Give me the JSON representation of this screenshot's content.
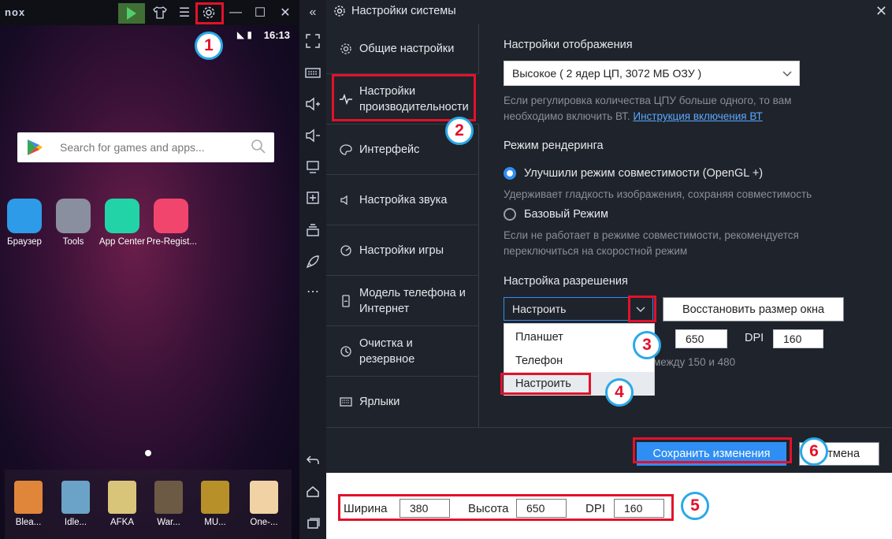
{
  "emulator": {
    "logo": "nox",
    "time": "16:13",
    "search_placeholder": "Search for games and apps...",
    "apps": [
      {
        "label": "Браузер",
        "color": "#2d9be8"
      },
      {
        "label": "Tools",
        "color": "#8a8fa0"
      },
      {
        "label": "App Center",
        "color": "#23d3a8"
      },
      {
        "label": "Pre-Regist...",
        "color": "#f2456e"
      }
    ],
    "dock_apps": [
      {
        "label": "Blea...",
        "color": "#e0863a"
      },
      {
        "label": "Idle...",
        "color": "#6aa3c7"
      },
      {
        "label": "AFKA",
        "color": "#d9c57a"
      },
      {
        "label": "War...",
        "color": "#6c5a45"
      },
      {
        "label": "MU...",
        "color": "#b8902a"
      },
      {
        "label": "One-...",
        "color": "#f0d2a4"
      }
    ]
  },
  "settings": {
    "title": "Настройки системы",
    "sidebar": [
      {
        "label": "Общие настройки",
        "icon": "gear-icon"
      },
      {
        "label": "Настройки производительности",
        "icon": "pulse-icon"
      },
      {
        "label": "Интерфейс",
        "icon": "palette-icon"
      },
      {
        "label": "Настройка звука",
        "icon": "speaker-icon"
      },
      {
        "label": "Настройки игры",
        "icon": "gamepad-icon"
      },
      {
        "label": "Модель телефона и Интернет",
        "icon": "phone-wifi-icon"
      },
      {
        "label": "Очистка и резервное",
        "icon": "history-icon"
      },
      {
        "label": "Ярлыки",
        "icon": "keyboard-icon"
      }
    ],
    "display": {
      "heading": "Настройки отображения",
      "value": "Высокое ( 2 ядер ЦП, 3072 МБ ОЗУ )",
      "note_line1": "Если регулировка количества ЦПУ больше одного, то вам",
      "note_line2_prefix": "необходимо включить ВТ.",
      "note_link": "Инструкция включения ВТ"
    },
    "render": {
      "heading": "Режим рендеринга",
      "option1": "Улучшили режим совместимости (OpenGL +)",
      "option1_note": "Удерживает гладкость изображения, сохраняя совместимость",
      "option2": "Базовый Режим",
      "option2_note_line1": "Если не работает в режиме совместимости, рекомендуется",
      "option2_note_line2": "переключиться на скоростной режим"
    },
    "resolution": {
      "heading": "Настройка разрешения",
      "value": "Настроить",
      "restore_button": "Восстановить размер окна",
      "height_value": "650",
      "dpi_label": "DPI",
      "dpi_value": "160",
      "dpi_note": "между 150 и 480",
      "options": [
        "Планшет",
        "Телефон",
        "Настроить"
      ]
    },
    "save_button": "Сохранить изменения",
    "cancel_button": "Отмена"
  },
  "bottom_panel": {
    "width_label": "Ширина",
    "width_value": "380",
    "height_label": "Высота",
    "height_value": "650",
    "dpi_label": "DPI",
    "dpi_value": "160"
  },
  "callouts": [
    "1",
    "2",
    "3",
    "4",
    "5",
    "6"
  ],
  "colors": {
    "accent": "#2f8ef3",
    "highlight": "#e3112b",
    "badge_border": "#2aa9e8"
  }
}
